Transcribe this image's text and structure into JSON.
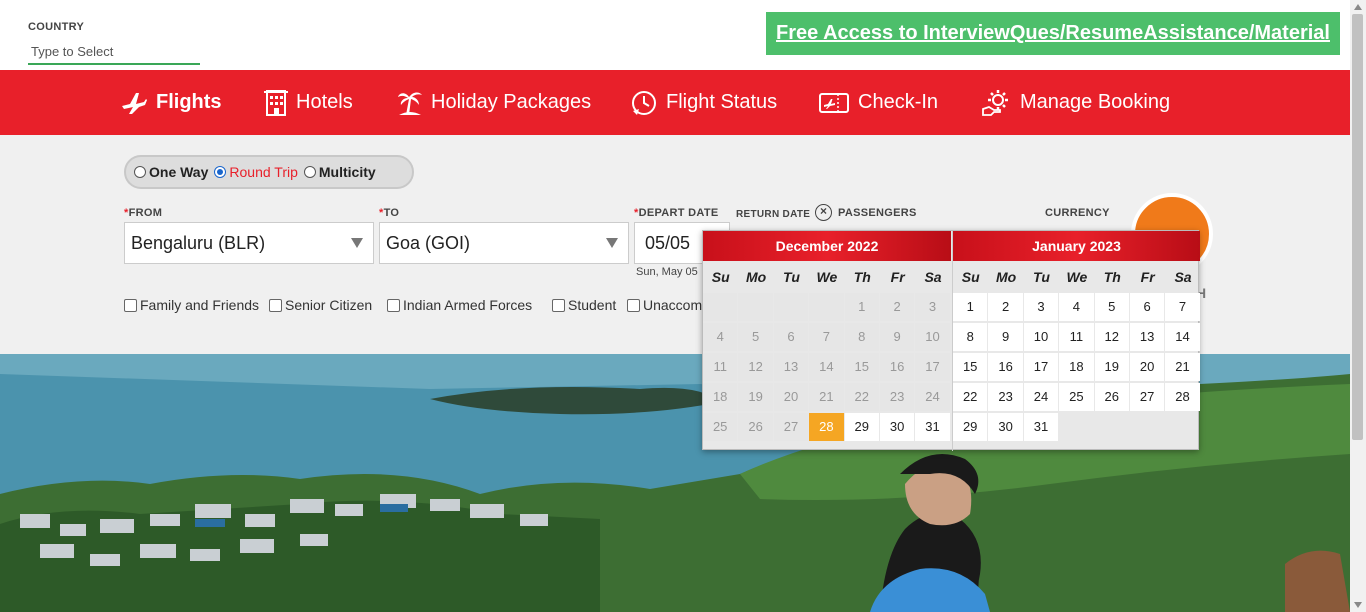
{
  "country": {
    "label": "COUNTRY",
    "placeholder": "Type to Select"
  },
  "promo": {
    "text": "Free Access to InterviewQues/ResumeAssistance/Material"
  },
  "nav": {
    "items": [
      {
        "label": "Flights",
        "icon": "plane-icon"
      },
      {
        "label": "Hotels",
        "icon": "hotel-icon"
      },
      {
        "label": "Holiday Packages",
        "icon": "palm-tree-icon"
      },
      {
        "label": "Flight Status",
        "icon": "clock-plane-icon"
      },
      {
        "label": "Check-In",
        "icon": "ticket-icon"
      },
      {
        "label": "Manage Booking",
        "icon": "gear-hand-icon"
      }
    ]
  },
  "trip": {
    "one_way": "One Way",
    "round_trip": "Round Trip",
    "multicity": "Multicity"
  },
  "form": {
    "from_label": "FROM",
    "from_value": "Bengaluru (BLR)",
    "to_label": "TO",
    "to_value": "Goa (GOI)",
    "depart_label": "DEPART DATE",
    "depart_value": "05/05",
    "depart_sub": "Sun, May 05",
    "return_label": "RETURN DATE",
    "passengers_label": "PASSENGERS",
    "currency_label": "CURRENCY",
    "search_partial": "H"
  },
  "options": {
    "family": "Family and Friends",
    "senior": "Senior Citizen",
    "armed": "Indian Armed Forces",
    "student": "Student",
    "unaccompanied": "Unaccom"
  },
  "calendar": {
    "weekdays": [
      "Su",
      "Mo",
      "Tu",
      "We",
      "Th",
      "Fr",
      "Sa"
    ],
    "left": {
      "title": "December 2022",
      "leading_blank": 4,
      "days": [
        "1",
        "2",
        "3",
        "4",
        "5",
        "6",
        "7",
        "8",
        "9",
        "10",
        "11",
        "12",
        "13",
        "14",
        "15",
        "16",
        "17",
        "18",
        "19",
        "20",
        "21",
        "22",
        "23",
        "24",
        "25",
        "26",
        "27",
        "28",
        "29",
        "30",
        "31"
      ],
      "active_from": 28,
      "selected": 28
    },
    "right": {
      "title": "January 2023",
      "leading_blank": 0,
      "days": [
        "1",
        "2",
        "3",
        "4",
        "5",
        "6",
        "7",
        "8",
        "9",
        "10",
        "11",
        "12",
        "13",
        "14",
        "15",
        "16",
        "17",
        "18",
        "19",
        "20",
        "21",
        "22",
        "23",
        "24",
        "25",
        "26",
        "27",
        "28",
        "29",
        "30",
        "31"
      ],
      "active_from": 1,
      "selected": null
    }
  },
  "colors": {
    "brand_red": "#e8202a",
    "promo_green": "#4dbf6b",
    "selected_day": "#f5a623",
    "search_orange": "#f07a1a"
  }
}
